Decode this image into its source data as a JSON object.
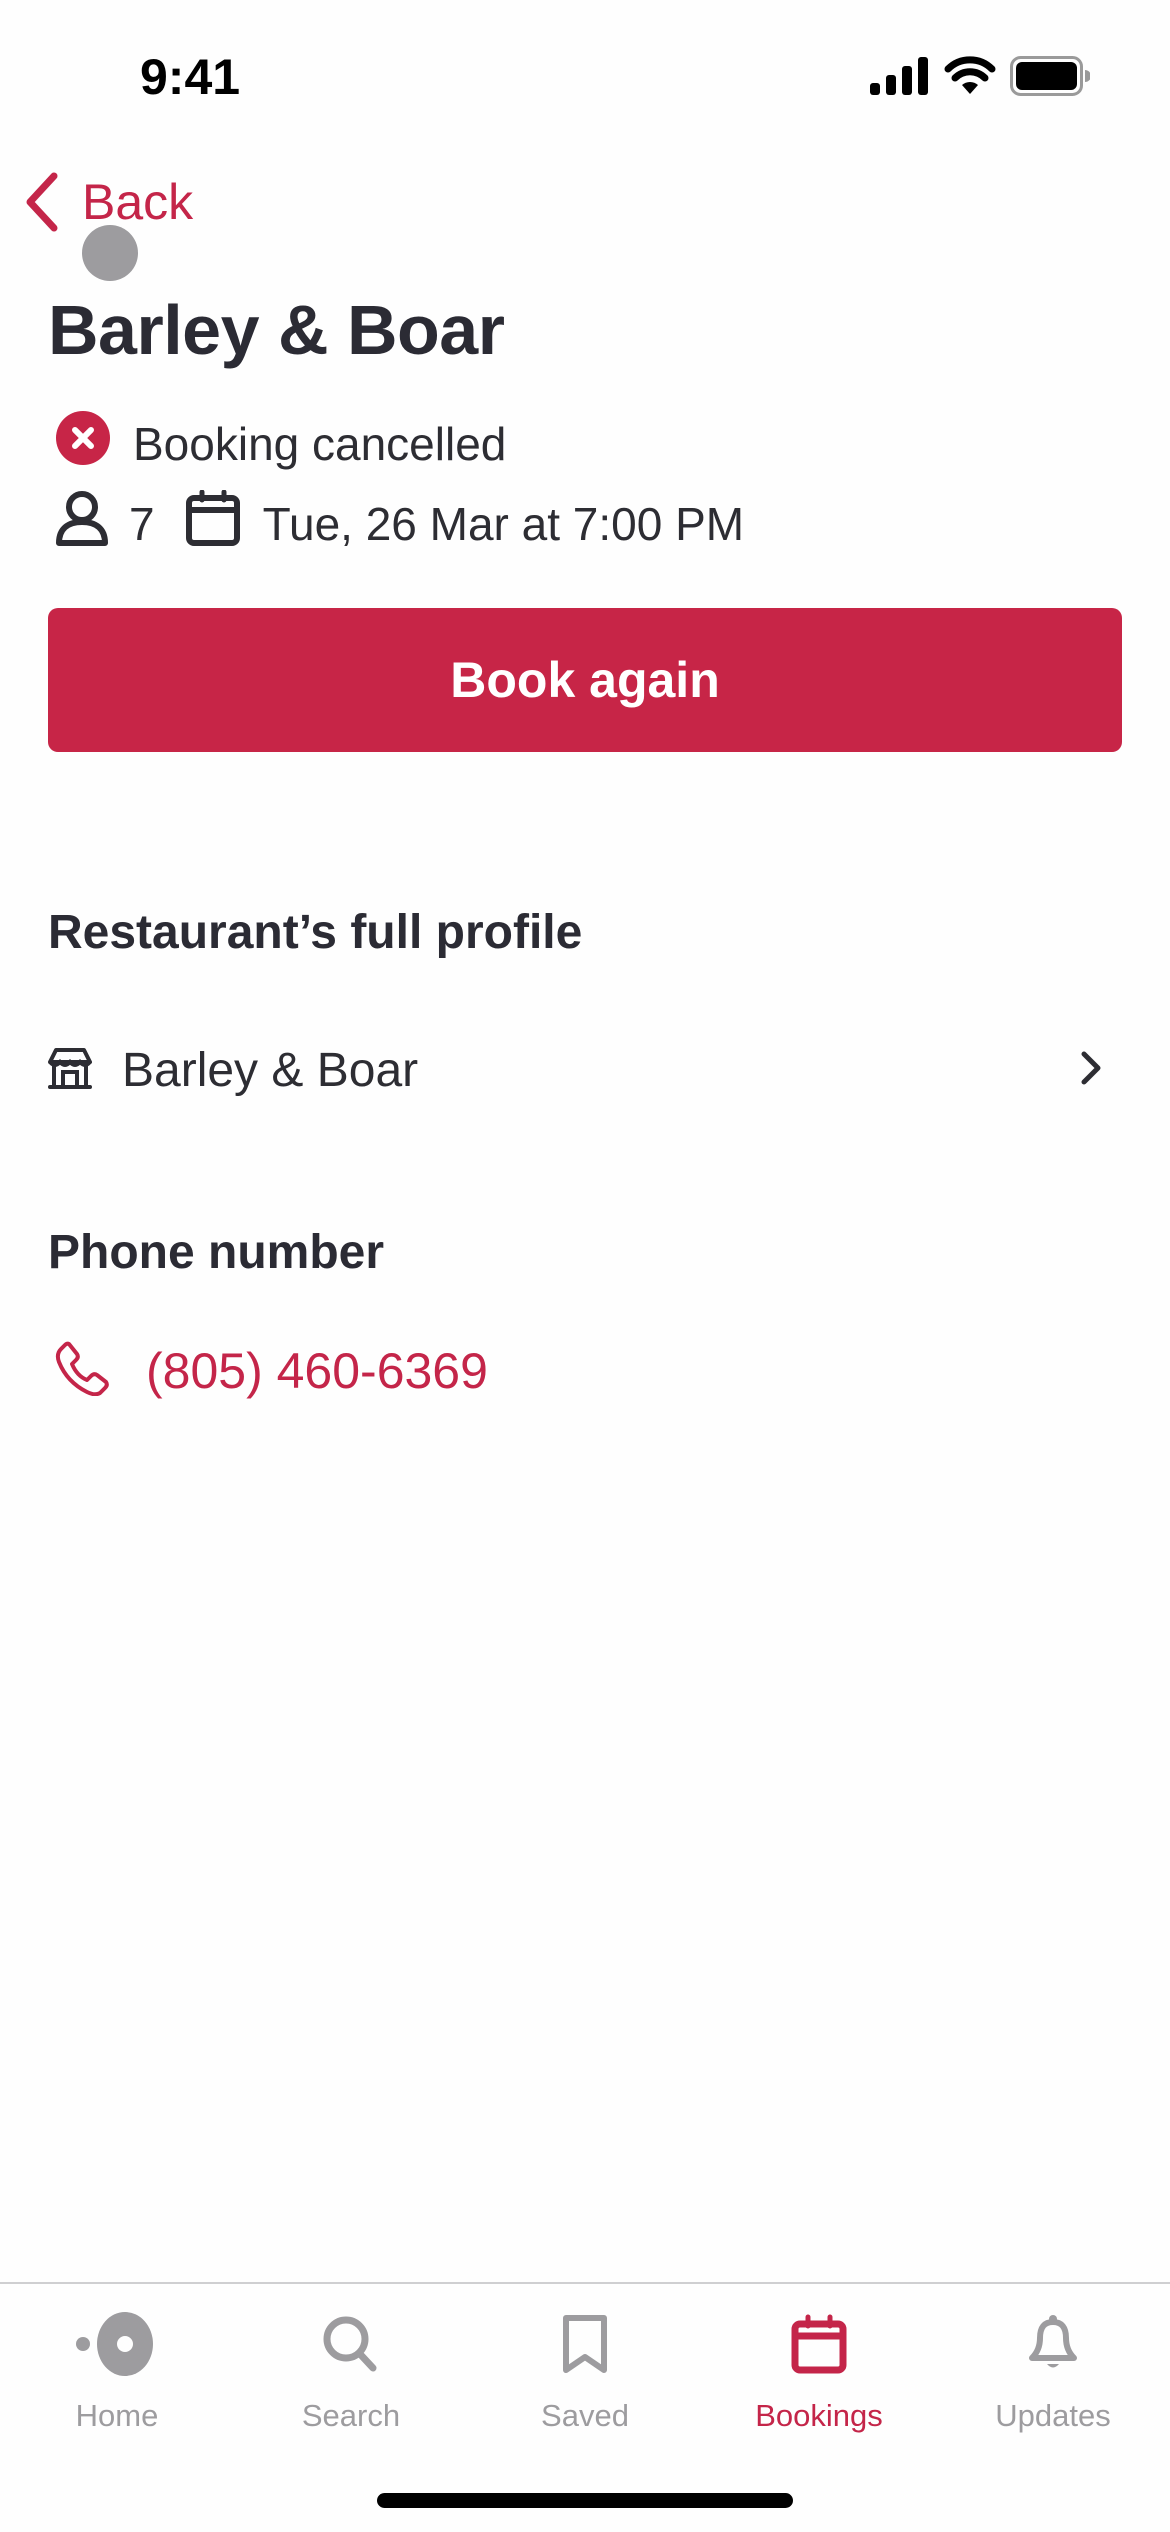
{
  "status_bar": {
    "time": "9:41",
    "icons": [
      "cellular-signal-icon",
      "wifi-icon",
      "battery-icon"
    ]
  },
  "nav": {
    "back_label": "Back"
  },
  "booking": {
    "restaurant_name": "Barley & Boar",
    "status_text": "Booking cancelled",
    "status_icon": "x-circle-icon",
    "guests": "7",
    "datetime": "Tue, 26 Mar at 7:00 PM",
    "book_again_label": "Book again"
  },
  "profile_section": {
    "heading": "Restaurant’s full profile",
    "restaurant_link": "Barley & Boar"
  },
  "phone_section": {
    "heading": "Phone number",
    "phone": "(805) 460-6369"
  },
  "tab_bar": {
    "tabs": [
      {
        "label": "Home",
        "icon": "home-icon",
        "active": false
      },
      {
        "label": "Search",
        "icon": "search-icon",
        "active": false
      },
      {
        "label": "Saved",
        "icon": "bookmark-icon",
        "active": false
      },
      {
        "label": "Bookings",
        "icon": "calendar-icon",
        "active": true
      },
      {
        "label": "Updates",
        "icon": "bell-icon",
        "active": false
      }
    ]
  },
  "colors": {
    "accent": "#c72547",
    "text": "#2b2b34",
    "inactive": "#9d9c9f"
  }
}
